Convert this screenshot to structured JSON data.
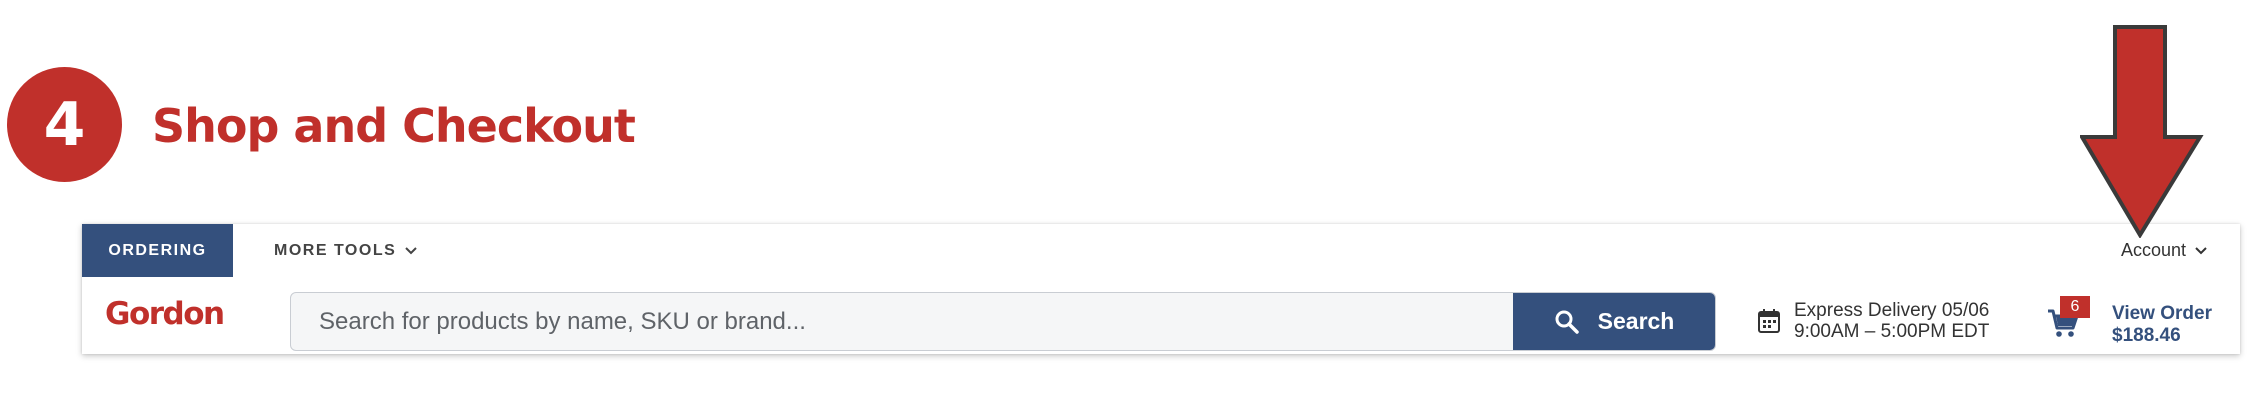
{
  "step": {
    "number": "4",
    "title": "Shop and Checkout"
  },
  "topnav": {
    "ordering_label": "ORDERING",
    "more_tools_label": "MORE TOOLS",
    "account_label": "Account"
  },
  "brand": {
    "logo_text": "Gordon"
  },
  "search": {
    "placeholder": "Search for products by name, SKU or brand...",
    "value": "",
    "button_label": "Search"
  },
  "delivery": {
    "line1": "Express Delivery 05/06",
    "line2": "9:00AM – 5:00PM EDT"
  },
  "cart": {
    "count": "6",
    "view_order_label": "View Order",
    "total": "$188.46"
  },
  "colors": {
    "accent_red": "#c0302b",
    "nav_blue": "#34507d"
  },
  "icons": [
    "chevron-down-icon",
    "search-icon",
    "calendar-icon",
    "cart-icon",
    "down-arrow-icon"
  ]
}
